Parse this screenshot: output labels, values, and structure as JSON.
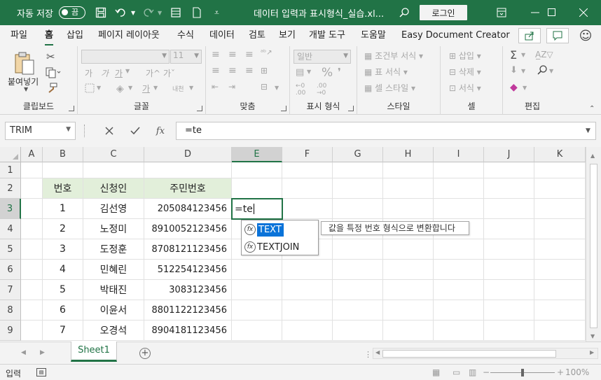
{
  "titlebar": {
    "autosave_label": "자동 저장",
    "autosave_state": "끔",
    "doc_title": "데이터 입력과 표시형식_실습.xl...",
    "login_label": "로그인"
  },
  "menu": {
    "tabs": [
      "파일",
      "홈",
      "삽입",
      "페이지 레이아웃",
      "수식",
      "데이터",
      "검토",
      "보기",
      "개발 도구",
      "도움말",
      "Easy Document Creator"
    ],
    "active": "홈"
  },
  "ribbon": {
    "groups": {
      "clipboard": "클립보드",
      "font": "글꼴",
      "alignment": "맞춤",
      "number": "표시 형식",
      "styles": "스타일",
      "cells": "셀",
      "editing": "편집"
    },
    "paste_label": "붙여넣기",
    "font_size": "11",
    "number_format": "일반",
    "conditional_format": "조건부 서식",
    "format_as_table": "표 서식",
    "cell_styles": "셀 스타일",
    "insert": "삽입",
    "delete": "삭제",
    "format": "서식",
    "font_bold": "가",
    "font_italic": "가",
    "font_underline": "가",
    "font_grow": "가^",
    "font_shrink": "가ˇ",
    "phonetic": "내천"
  },
  "formula_bar": {
    "name_box": "TRIM",
    "formula": "=te"
  },
  "grid": {
    "columns": [
      "A",
      "B",
      "C",
      "D",
      "E",
      "F",
      "G",
      "H",
      "I",
      "J",
      "K"
    ],
    "rows": [
      "1",
      "2",
      "3",
      "4",
      "5",
      "6",
      "7",
      "8",
      "9"
    ],
    "active_column": "E",
    "active_row": "3",
    "header_row": [
      "번호",
      "신청인",
      "주민번호"
    ],
    "data_rows": [
      [
        "1",
        "김선영",
        "205084123456"
      ],
      [
        "2",
        "노정미",
        "8910052123456"
      ],
      [
        "3",
        "도정훈",
        "8708121123456"
      ],
      [
        "4",
        "민혜린",
        "512254123456"
      ],
      [
        "5",
        "박태진",
        "3083123456"
      ],
      [
        "6",
        "이윤서",
        "8801122123456"
      ],
      [
        "7",
        "오경석",
        "8904181123456"
      ]
    ],
    "active_cell_text": "=te"
  },
  "autocomplete": {
    "items": [
      "TEXT",
      "TEXTJOIN"
    ],
    "tooltip": "값을 특정 번호 형식으로 변환합니다"
  },
  "sheets": {
    "tabs": [
      "Sheet1"
    ]
  },
  "status": {
    "mode": "입력",
    "zoom": "100%"
  },
  "colors": {
    "excel_green": "#217346",
    "header_fill": "#e2efda",
    "ac_highlight": "#0a73d9"
  }
}
